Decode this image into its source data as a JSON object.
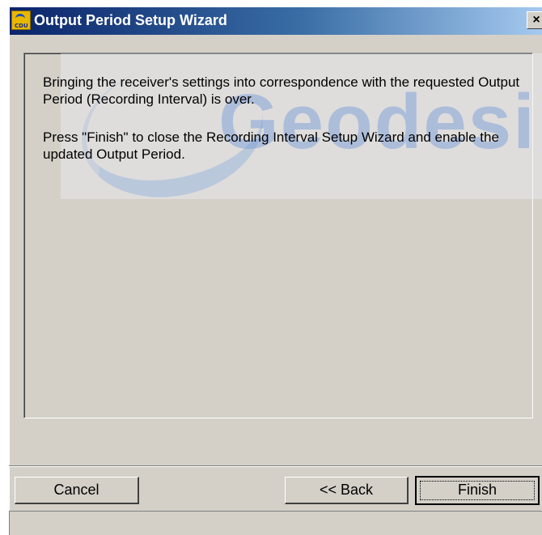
{
  "window": {
    "title": "Output Period Setup Wizard",
    "icon": "cdu-app-icon",
    "icon_label": "CDU",
    "close_label": "×"
  },
  "content": {
    "message_1": "Bringing the receiver's settings into correspondence with the requested Output Period (Recording Interval) is over.",
    "message_2": "Press \"Finish\" to close the Recording Interval Setup Wizard and enable the updated Output Period."
  },
  "watermark": {
    "text": "Geodesi"
  },
  "buttons": {
    "cancel": "Cancel",
    "back": "<< Back",
    "finish": "Finish"
  },
  "colors": {
    "titlebar_start": "#0a246a",
    "titlebar_end": "#a6caf0",
    "dialog_face": "#d4d0c8"
  }
}
